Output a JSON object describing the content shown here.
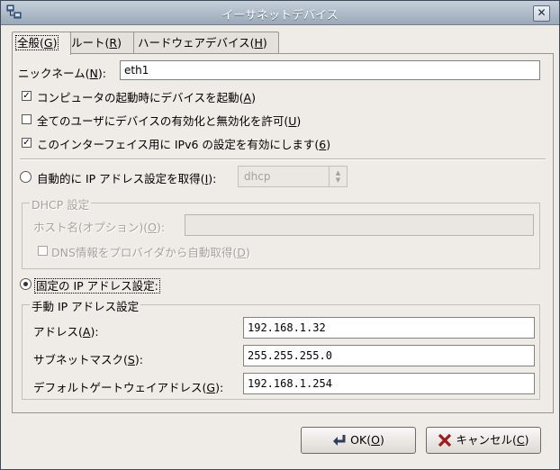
{
  "window": {
    "title": "イーサネットデバイス",
    "close_glyph": "✕"
  },
  "tabs": [
    {
      "label": "全般(",
      "mnemonic": "G",
      "suffix": ")"
    },
    {
      "label": "ルート(",
      "mnemonic": "R",
      "suffix": ")"
    },
    {
      "label": "ハードウェアデバイス(",
      "mnemonic": "H",
      "suffix": ")"
    }
  ],
  "nickname": {
    "label": "ニックネーム(",
    "mnemonic": "N",
    "suffix": "):",
    "value": "eth1"
  },
  "options": {
    "activate_on_boot": {
      "label": "コンピュータの起動時にデバイスを起動(",
      "mnemonic": "A",
      "suffix": ")",
      "checked": true
    },
    "allow_users": {
      "label": "全てのユーザにデバイスの有効化と無効化を許可(",
      "mnemonic": "U",
      "suffix": ")",
      "checked": false
    },
    "enable_ipv6": {
      "label": "このインターフェイス用に IPv6 の設定を有効にします(",
      "mnemonic": "6",
      "suffix": ")",
      "checked": true
    }
  },
  "auto_ip": {
    "label": "自動的に IP アドレス設定を取得(",
    "mnemonic": "I",
    "suffix": "):",
    "selected": false,
    "method": "dhcp"
  },
  "dhcp": {
    "frame_title": "DHCP 設定",
    "hostname_label": "ホスト名(オプション)(",
    "hostname_mnemonic": "O",
    "hostname_suffix": "):",
    "hostname_value": "",
    "dns_label": "DNS情報をプロバイダから自動取得(",
    "dns_mnemonic": "D",
    "dns_suffix": ")",
    "dns_checked": false
  },
  "static_ip": {
    "label": "固定の IP アドレス設定:",
    "selected": true,
    "frame_title": "手動 IP アドレス設定",
    "address_label": "アドレス(",
    "address_mnemonic": "A",
    "address_suffix": "):",
    "address_value": "192.168.1.32",
    "subnet_label": "サブネットマスク(",
    "subnet_mnemonic": "S",
    "subnet_suffix": "):",
    "subnet_value": "255.255.255.0",
    "gateway_label": "デフォルトゲートウェイアドレス(",
    "gateway_mnemonic": "G",
    "gateway_suffix": "):",
    "gateway_value": "192.168.1.254"
  },
  "buttons": {
    "ok": {
      "label": "OK(",
      "mnemonic": "O",
      "suffix": ")"
    },
    "cancel": {
      "label": "キャンセル(",
      "mnemonic": "C",
      "suffix": ")"
    }
  },
  "check_glyph": "✓"
}
